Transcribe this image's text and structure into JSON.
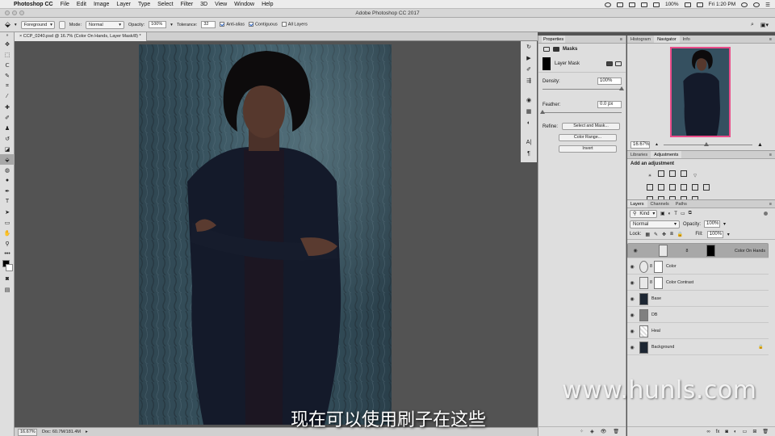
{
  "menubar": {
    "apple": "",
    "app_name": "Photoshop CC",
    "items": [
      "File",
      "Edit",
      "Image",
      "Layer",
      "Type",
      "Select",
      "Filter",
      "3D",
      "View",
      "Window",
      "Help"
    ],
    "battery": "100%",
    "time": "Fri 1:20 PM"
  },
  "window": {
    "title": "Adobe Photoshop CC 2017"
  },
  "options": {
    "preset": "Foreground",
    "mode_label": "Mode:",
    "mode_value": "Normal",
    "opacity_label": "Opacity:",
    "opacity_value": "100%",
    "tolerance_label": "Tolerance:",
    "tolerance_value": "32",
    "antialias": "Anti-alias",
    "contiguous": "Contiguous",
    "all_layers": "All Layers"
  },
  "document": {
    "tab_title": "CCP_0240.psd @ 16.7% (Color On Hands, Layer Mask/8) *",
    "zoom": "16.67%",
    "doc_size": "Doc: 60.7M/181.4M"
  },
  "properties": {
    "tab_label": "Properties",
    "masks_label": "Masks",
    "layer_mask_label": "Layer Mask",
    "density_label": "Density:",
    "density_value": "100%",
    "feather_label": "Feather:",
    "feather_value": "0.0 px",
    "refine_label": "Refine:",
    "select_mask_btn": "Select and Mask...",
    "color_range_btn": "Color Range...",
    "invert_btn": "Invert"
  },
  "navigator": {
    "tabs": [
      "Histogram",
      "Navigator",
      "Info"
    ],
    "active": "Navigator",
    "zoom": "16.67%"
  },
  "adjustments": {
    "tabs": [
      "Libraries",
      "Adjustments"
    ],
    "active": "Adjustments",
    "heading": "Add an adjustment"
  },
  "layers_panel": {
    "tabs": [
      "Layers",
      "Channels",
      "Paths"
    ],
    "active": "Layers",
    "filter_kind": "Kind",
    "blend_mode": "Normal",
    "opacity_label": "Opacity:",
    "opacity_value": "100%",
    "lock_label": "Lock:",
    "fill_label": "Fill:",
    "fill_value": "100%",
    "layers": [
      {
        "name": "Color On Hands",
        "selected": true
      },
      {
        "name": "Color",
        "selected": false
      },
      {
        "name": "Color Contrast",
        "selected": false
      },
      {
        "name": "Base",
        "selected": false
      },
      {
        "name": "DB",
        "selected": false
      },
      {
        "name": "Heal",
        "selected": false
      },
      {
        "name": "Background",
        "selected": false
      }
    ]
  },
  "overlay": {
    "watermark": "www.hunls.com",
    "subtitle": "现在可以使用刷子在这些"
  },
  "colors": {
    "accent": "#ea4c89",
    "selected_layer": "#a8a8a8"
  }
}
